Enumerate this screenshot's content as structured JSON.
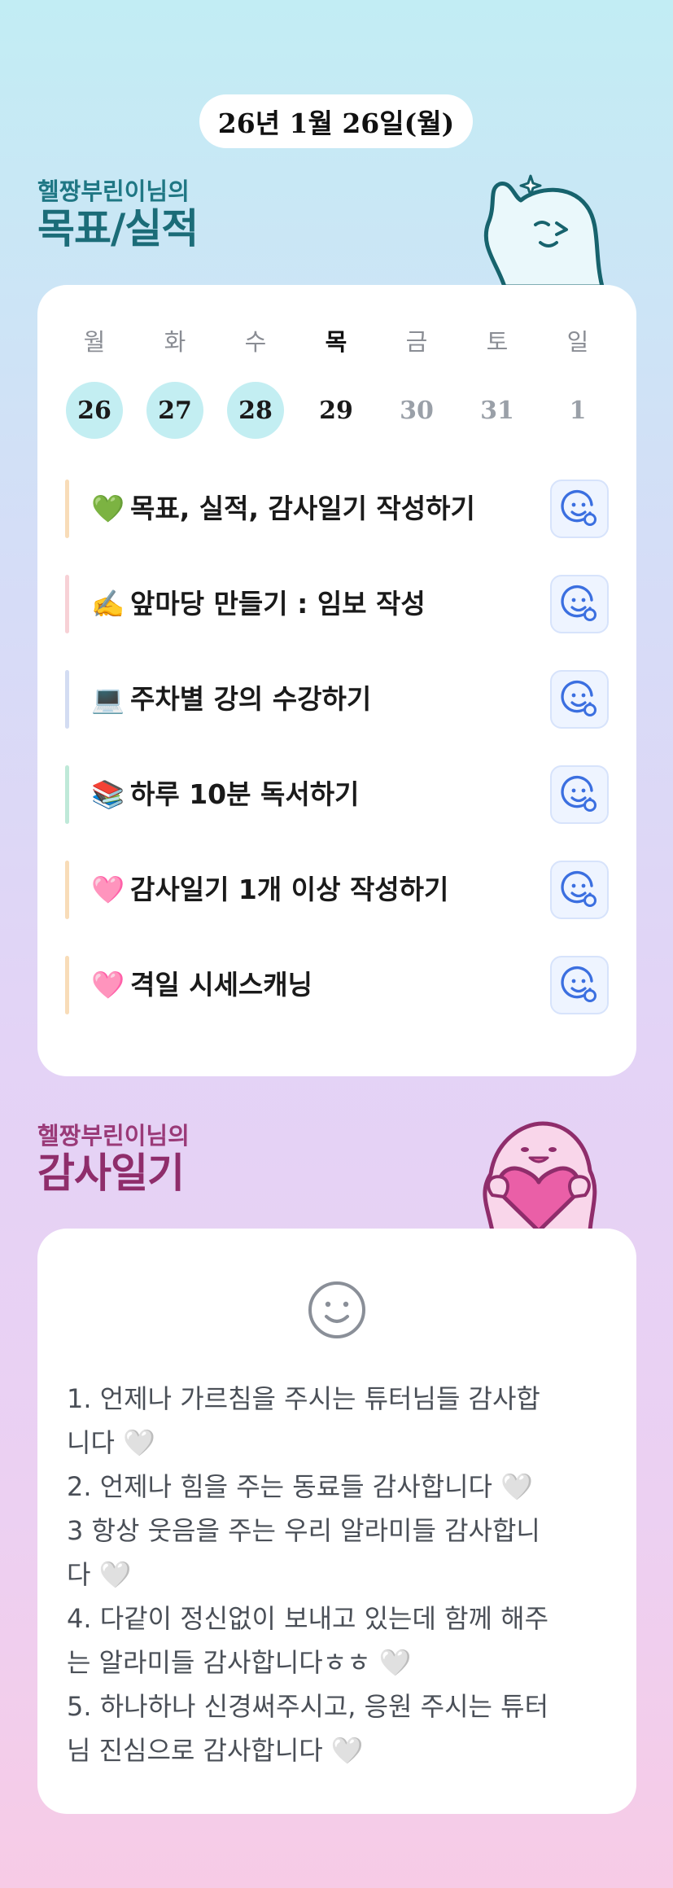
{
  "header": {
    "date": "26년 1월 26일(월)"
  },
  "goals_section": {
    "subtitle": "헬짱부린이님의",
    "title": "목표/실적"
  },
  "week": {
    "days": [
      {
        "name": "월",
        "date": "26",
        "state": "done"
      },
      {
        "name": "화",
        "date": "27",
        "state": "done"
      },
      {
        "name": "수",
        "date": "28",
        "state": "done"
      },
      {
        "name": "목",
        "date": "29",
        "state": "today"
      },
      {
        "name": "금",
        "date": "30",
        "state": "future"
      },
      {
        "name": "토",
        "date": "31",
        "state": "future"
      },
      {
        "name": "일",
        "date": "1",
        "state": "future"
      }
    ]
  },
  "goals": [
    {
      "emoji": "💚",
      "text": "목표, 실적, 감사일기 작성하기",
      "bar_color": "#f8dcb8",
      "icon": "smiley-add-icon"
    },
    {
      "emoji": "✍️",
      "text": "앞마당 만들기 : 임보 작성",
      "bar_color": "#f7d1d6",
      "icon": "smiley-add-icon"
    },
    {
      "emoji": "💻",
      "text": "주차별 강의 수강하기",
      "bar_color": "#d3dcf2",
      "icon": "smiley-add-icon"
    },
    {
      "emoji": "📚",
      "text": "하루 10분 독서하기",
      "bar_color": "#bfe9d8",
      "icon": "smiley-add-icon"
    },
    {
      "emoji": "🩷",
      "text": "감사일기 1개 이상 작성하기",
      "bar_color": "#f8dcb8",
      "icon": "smiley-add-icon"
    },
    {
      "emoji": "🩷",
      "text": "격일 시세스캐닝",
      "bar_color": "#f8dcb8",
      "icon": "smiley-add-icon"
    }
  ],
  "gratitude_section": {
    "subtitle": "헬짱부린이님의",
    "title": "감사일기"
  },
  "gratitude": {
    "icon": "smiley-icon",
    "lines": [
      "1. 언제나 가르침을 주시는 튜터님들 감사합",
      "니다 🤍",
      "2. 언제나 힘을 주는 동료들 감사합니다 🤍",
      "3 항상 웃음을 주는 우리 알라미들 감사합니",
      "다 🤍",
      "4. 다같이 정신없이 보내고 있는데 함께 해주",
      "는 알라미들 감사합니다ㅎㅎ 🤍",
      "5. 하나하나 신경써주시고, 응원 주시는 튜터",
      "님 진심으로 감사합니다 🤍"
    ]
  },
  "colors": {
    "goals_title": "#1b6c78",
    "gratitude_title": "#8f2d6b",
    "done_day": "#c3eef2",
    "action_blue": "#3b6fe0"
  }
}
